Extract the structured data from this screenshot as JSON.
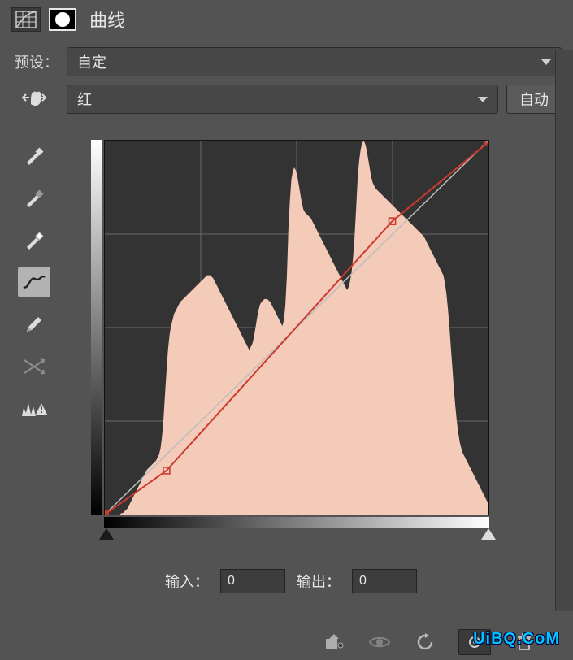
{
  "panel": {
    "title": "曲线"
  },
  "preset": {
    "label": "预设：",
    "value": "自定"
  },
  "channel": {
    "value": "红",
    "auto_label": "自动"
  },
  "io": {
    "input_label": "输入：",
    "input_value": "0",
    "output_label": "输出：",
    "output_value": "0"
  },
  "colors": {
    "histogram_fill": "#f4cbb8",
    "curve_stroke": "#cc3a2f",
    "baseline_stroke": "#bdbdbd"
  },
  "watermark": "UiBQ.CoM",
  "chart_data": {
    "type": "line",
    "title": "Curves — Red channel",
    "xlabel": "输入",
    "ylabel": "输出",
    "xlim": [
      0,
      255
    ],
    "ylim": [
      0,
      255
    ],
    "grid": true,
    "curve_points": [
      {
        "x": 0,
        "y": 0
      },
      {
        "x": 41,
        "y": 30
      },
      {
        "x": 191,
        "y": 200
      },
      {
        "x": 255,
        "y": 254
      }
    ],
    "baseline": [
      {
        "x": 0,
        "y": 0
      },
      {
        "x": 255,
        "y": 255
      }
    ],
    "histogram_bins_256": [
      0,
      0,
      0,
      0,
      0,
      0,
      0,
      0,
      0,
      0,
      0,
      1,
      1,
      2,
      3,
      4,
      6,
      8,
      10,
      12,
      14,
      16,
      18,
      20,
      22,
      24,
      26,
      28,
      30,
      31,
      32,
      33,
      34,
      35,
      36,
      38,
      40,
      44,
      52,
      64,
      80,
      96,
      110,
      120,
      126,
      130,
      134,
      136,
      138,
      140,
      142,
      143,
      144,
      145,
      146,
      147,
      148,
      149,
      150,
      151,
      152,
      153,
      154,
      155,
      156,
      157,
      158,
      159,
      160,
      160,
      160,
      159,
      158,
      156,
      154,
      152,
      150,
      148,
      146,
      144,
      142,
      140,
      138,
      136,
      134,
      132,
      130,
      128,
      126,
      124,
      122,
      120,
      118,
      116,
      114,
      112,
      110,
      112,
      114,
      118,
      124,
      130,
      136,
      140,
      142,
      143,
      144,
      144,
      144,
      143,
      142,
      140,
      138,
      136,
      134,
      132,
      130,
      128,
      126,
      130,
      140,
      160,
      190,
      210,
      224,
      230,
      232,
      230,
      226,
      220,
      214,
      208,
      204,
      202,
      201,
      200,
      199,
      198,
      196,
      194,
      192,
      190,
      188,
      186,
      184,
      182,
      180,
      178,
      176,
      174,
      172,
      170,
      168,
      166,
      164,
      162,
      160,
      158,
      156,
      154,
      152,
      150,
      152,
      156,
      162,
      172,
      186,
      204,
      224,
      236,
      244,
      248,
      250,
      248,
      244,
      238,
      232,
      226,
      222,
      220,
      218,
      217,
      216,
      215,
      214,
      213,
      212,
      211,
      210,
      209,
      208,
      207,
      206,
      205,
      204,
      203,
      202,
      201,
      200,
      199,
      198,
      197,
      196,
      195,
      194,
      193,
      192,
      191,
      190,
      189,
      188,
      187,
      186,
      184,
      182,
      180,
      178,
      176,
      174,
      172,
      170,
      168,
      166,
      164,
      162,
      160,
      155,
      148,
      138,
      126,
      112,
      98,
      84,
      72,
      62,
      54,
      48,
      44,
      41,
      39,
      37,
      35,
      33,
      31,
      29,
      27,
      25,
      23,
      21,
      19,
      17,
      15,
      13,
      11,
      9,
      7
    ]
  }
}
